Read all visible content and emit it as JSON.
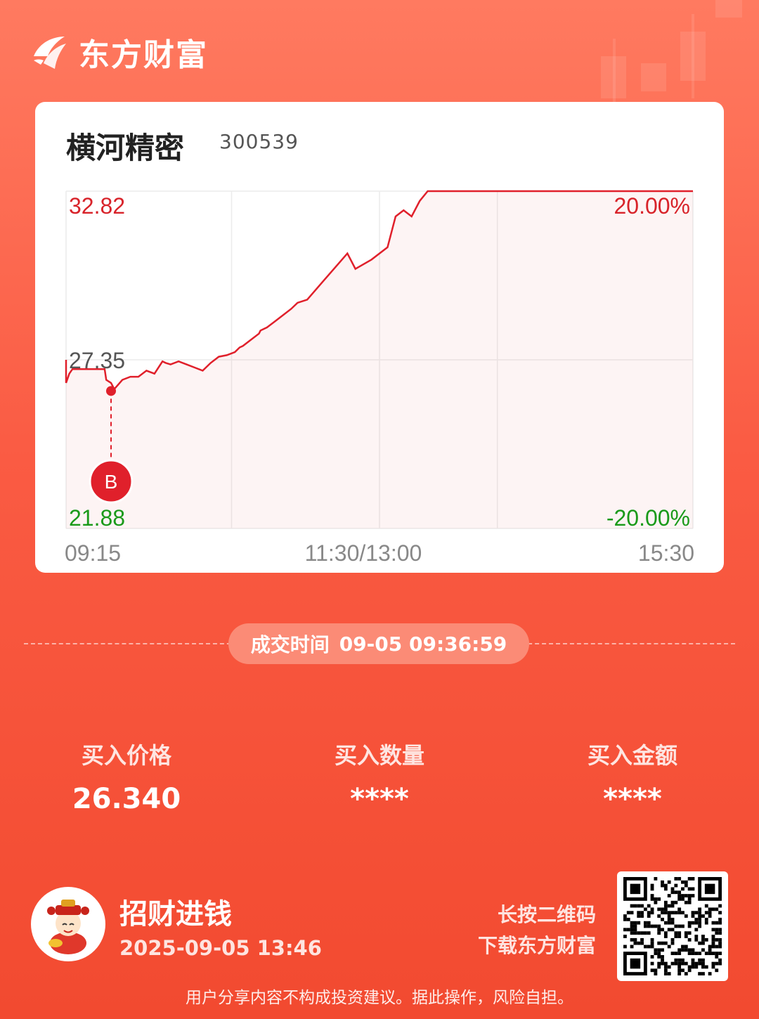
{
  "brand": {
    "name": "东方财富"
  },
  "stock": {
    "name": "横河精密",
    "code": "300539"
  },
  "chart_data": {
    "type": "line",
    "title": "",
    "y_labels": {
      "top": "32.82",
      "mid": "27.35",
      "bottom": "21.88"
    },
    "pct_labels": {
      "top": "20.00%",
      "bottom": "-20.00%"
    },
    "x_labels": [
      "09:15",
      "11:30/13:00",
      "15:30"
    ],
    "ylim": [
      21.88,
      32.82
    ],
    "reference_price": 27.35,
    "x_unit": "trading minutes from 09:30 (0–240)",
    "series": [
      {
        "x": [
          -15,
          0,
          2,
          4,
          10,
          20,
          24,
          25,
          28,
          30,
          35,
          40,
          45,
          50,
          55,
          60,
          62,
          65,
          70,
          75,
          80,
          85,
          90,
          95,
          100,
          105,
          108,
          110,
          115,
          120,
          121,
          125,
          130,
          135,
          140,
          144,
          150,
          160,
          170,
          175,
          180,
          190,
          200,
          205,
          210,
          215,
          220,
          225,
          230,
          235,
          240,
          245,
          250,
          258,
          260,
          270,
          280,
          285,
          290,
          300,
          320,
          335,
          340,
          345,
          350,
          360,
          380,
          390
        ],
        "y": [
          27.35,
          26.6,
          26.9,
          27.05,
          27.05,
          27.05,
          27.05,
          26.7,
          26.6,
          26.4,
          26.7,
          26.8,
          26.8,
          27.0,
          26.9,
          27.3,
          27.25,
          27.2,
          27.3,
          27.2,
          27.1,
          27.0,
          27.25,
          27.45,
          27.5,
          27.6,
          27.75,
          27.8,
          28.0,
          28.2,
          28.3,
          28.4,
          28.6,
          28.8,
          29.0,
          29.2,
          29.3,
          29.9,
          30.5,
          30.8,
          30.3,
          30.6,
          31.0,
          32.0,
          32.2,
          32.0,
          32.5,
          32.82,
          32.82,
          32.82,
          32.82,
          32.82,
          32.82,
          32.82,
          32.82,
          32.82,
          32.82,
          32.82,
          32.82,
          32.82,
          32.82,
          32.82,
          32.82,
          32.82,
          32.82,
          32.82,
          32.82,
          32.82
        ]
      }
    ],
    "buy_marker": {
      "label": "B",
      "price": 26.34
    }
  },
  "trade": {
    "time_label": "成交时间",
    "time_value": "09-05 09:36:59"
  },
  "stats": [
    {
      "label": "买入价格",
      "value": "26.340"
    },
    {
      "label": "买入数量",
      "value": "****"
    },
    {
      "label": "买入金额",
      "value": "****"
    }
  ],
  "user": {
    "name": "招财进钱",
    "date": "2025-09-05 13:46"
  },
  "qr": {
    "line1": "长按二维码",
    "line2": "下载东方财富"
  },
  "disclaimer": "用户分享内容不构成投资建议。据此操作，风险自担。",
  "colors": {
    "up": "#e0202b",
    "down": "#1a9a1a",
    "accent": "#f24a30"
  }
}
